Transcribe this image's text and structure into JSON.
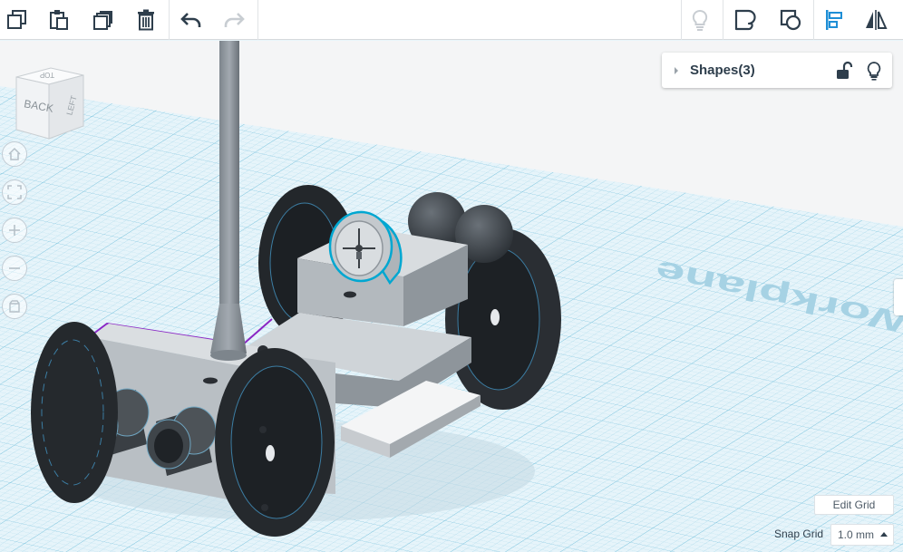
{
  "toolbar": {
    "left_tools": [
      {
        "name": "copy-button",
        "icon": "copy-icon"
      },
      {
        "name": "paste-button",
        "icon": "paste-icon"
      },
      {
        "name": "duplicate-button",
        "icon": "duplicate-icon"
      },
      {
        "name": "delete-button",
        "icon": "trash-icon"
      },
      {
        "name": "undo-button",
        "icon": "undo-icon"
      },
      {
        "name": "redo-button",
        "icon": "redo-icon"
      }
    ],
    "right_tools": [
      {
        "name": "notes-button",
        "icon": "lightbulb-icon"
      },
      {
        "name": "group-button",
        "icon": "group-icon"
      },
      {
        "name": "ungroup-button",
        "icon": "ungroup-icon"
      },
      {
        "name": "align-button",
        "icon": "align-icon"
      },
      {
        "name": "mirror-button",
        "icon": "mirror-icon"
      }
    ]
  },
  "view_cube": {
    "faces": [
      "BACK",
      "LEFT"
    ],
    "top_face": "TOP"
  },
  "nav_controls": [
    "home-view-icon",
    "fit-view-icon",
    "zoom-in-icon",
    "zoom-out-icon",
    "perspective-icon"
  ],
  "shapes_panel": {
    "title": "Shapes(3)"
  },
  "workplane": {
    "label": "Workplane"
  },
  "bottom_controls": {
    "edit_grid_label": "Edit Grid",
    "snap_grid_label": "Snap Grid",
    "snap_grid_value": "1.0 mm"
  },
  "colors": {
    "grid_background": "#e9f5fa",
    "grid_line": "#9fd3e6",
    "selection_outline": "#00a7d1",
    "group_outline": "#8a26c4",
    "tire": "#25292d",
    "body_gray": "#c9ced3",
    "accent_blue": "#1f8fd6"
  }
}
